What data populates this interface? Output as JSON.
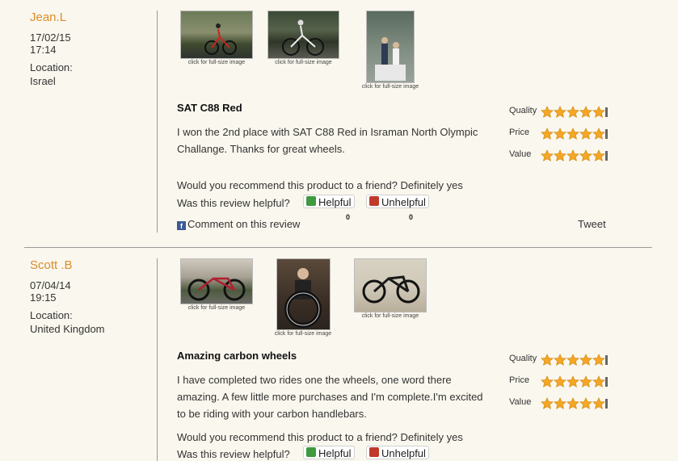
{
  "reviews": [
    {
      "author": "Jean.L",
      "date": "17/02/15",
      "time": "17:14",
      "location_label": "Location:",
      "location": "Israel",
      "thumb_caption": "click for full-size image",
      "title": "SAT C88 Red",
      "body_lines": [
        "I won the 2nd place with SAT C88 Red in Israman North Olympic",
        "Challange. Thanks for great wheels."
      ],
      "recommend": "Would you recommend this product to a friend? Definitely yes",
      "helpful_question": "Was this review helpful?",
      "helpful_label": "Helpful",
      "unhelpful_label": "Unhelpful",
      "helpful_count": "0",
      "unhelpful_count": "0",
      "comment_link": "Comment on this review",
      "tweet": "Tweet",
      "ratings": [
        {
          "label": "Quality",
          "stars": 5
        },
        {
          "label": "Price",
          "stars": 5
        },
        {
          "label": "Value",
          "stars": 5
        }
      ]
    },
    {
      "author": "Scott .B",
      "date": "07/04/14",
      "time": "19:15",
      "location_label": "Location:",
      "location": "United Kingdom",
      "thumb_caption": "click for full-size image",
      "title": "Amazing carbon wheels",
      "body_lines": [
        "I have completed two rides one the wheels, one word there",
        "amazing. A few little more purchases and I'm complete.I'm excited",
        "to be riding with your carbon handlebars."
      ],
      "recommend": "Would you recommend this product to a friend? Definitely yes",
      "helpful_question": "Was this review helpful?",
      "helpful_label": "Helpful",
      "unhelpful_label": "Unhelpful",
      "ratings": [
        {
          "label": "Quality",
          "stars": 5
        },
        {
          "label": "Price",
          "stars": 5
        },
        {
          "label": "Value",
          "stars": 5
        }
      ]
    }
  ],
  "colors": {
    "author": "#d98c2b",
    "star": "#f5a623",
    "background": "#faf7ee",
    "divider": "#9a9a9a"
  },
  "icons": [
    "thumbs-up-icon",
    "thumbs-down-icon",
    "facebook-icon",
    "star-icon"
  ]
}
